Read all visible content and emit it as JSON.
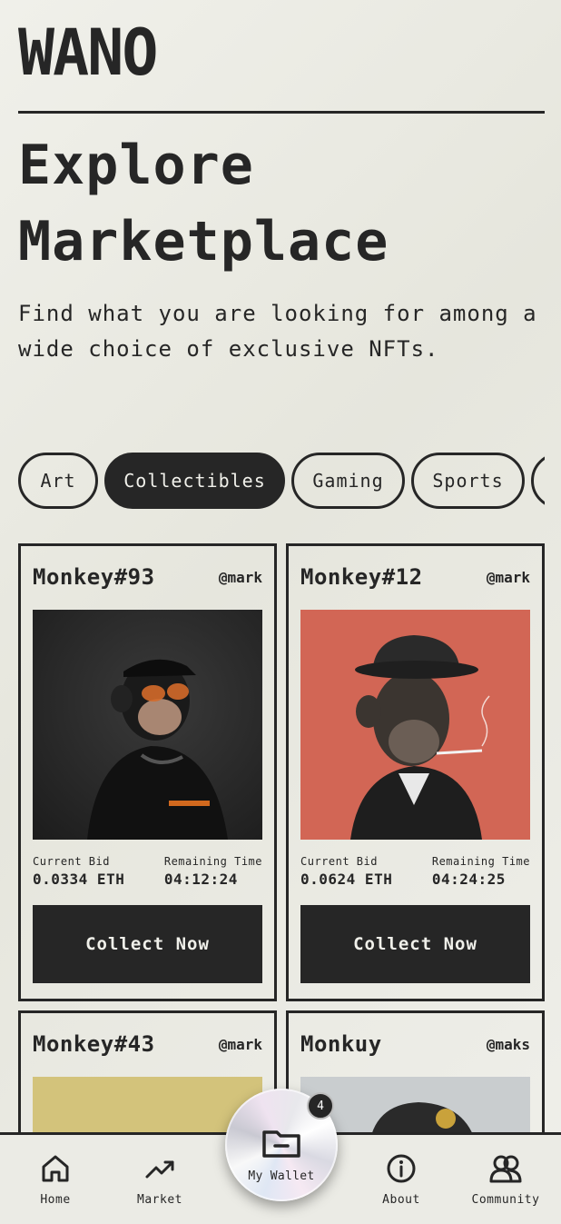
{
  "brand": {
    "logo": "WANO"
  },
  "hero": {
    "title_line1": "Explore",
    "title_line2": "Marketplace",
    "subtitle": "Find what you are looking for among a wide choice of exclusive NFTs."
  },
  "categories": [
    {
      "label": "Art",
      "active": false
    },
    {
      "label": "Collectibles",
      "active": true
    },
    {
      "label": "Gaming",
      "active": false
    },
    {
      "label": "Sports",
      "active": false
    }
  ],
  "cards": [
    {
      "name": "Monkey#93",
      "user": "@mark",
      "bid_label": "Current Bid",
      "bid": "0.0334 ETH",
      "time_label": "Remaining Time",
      "time": "04:12:24",
      "cta": "Collect Now",
      "bg": "#2a2a2a"
    },
    {
      "name": "Monkey#12",
      "user": "@mark",
      "bid_label": "Current Bid",
      "bid": "0.0624 ETH",
      "time_label": "Remaining Time",
      "time": "04:24:25",
      "cta": "Collect Now",
      "bg": "#d26655"
    },
    {
      "name": "Monkey#43",
      "user": "@mark",
      "bg": "#d3c37b"
    },
    {
      "name": "Monkuy",
      "user": "@maks",
      "bg": "#c9cdcf"
    }
  ],
  "nav": {
    "home": "Home",
    "market": "Market",
    "wallet": "My Wallet",
    "wallet_badge": "4",
    "about": "About",
    "community": "Community"
  },
  "colors": {
    "ink": "#262626",
    "paper": "#f0f0ea"
  }
}
